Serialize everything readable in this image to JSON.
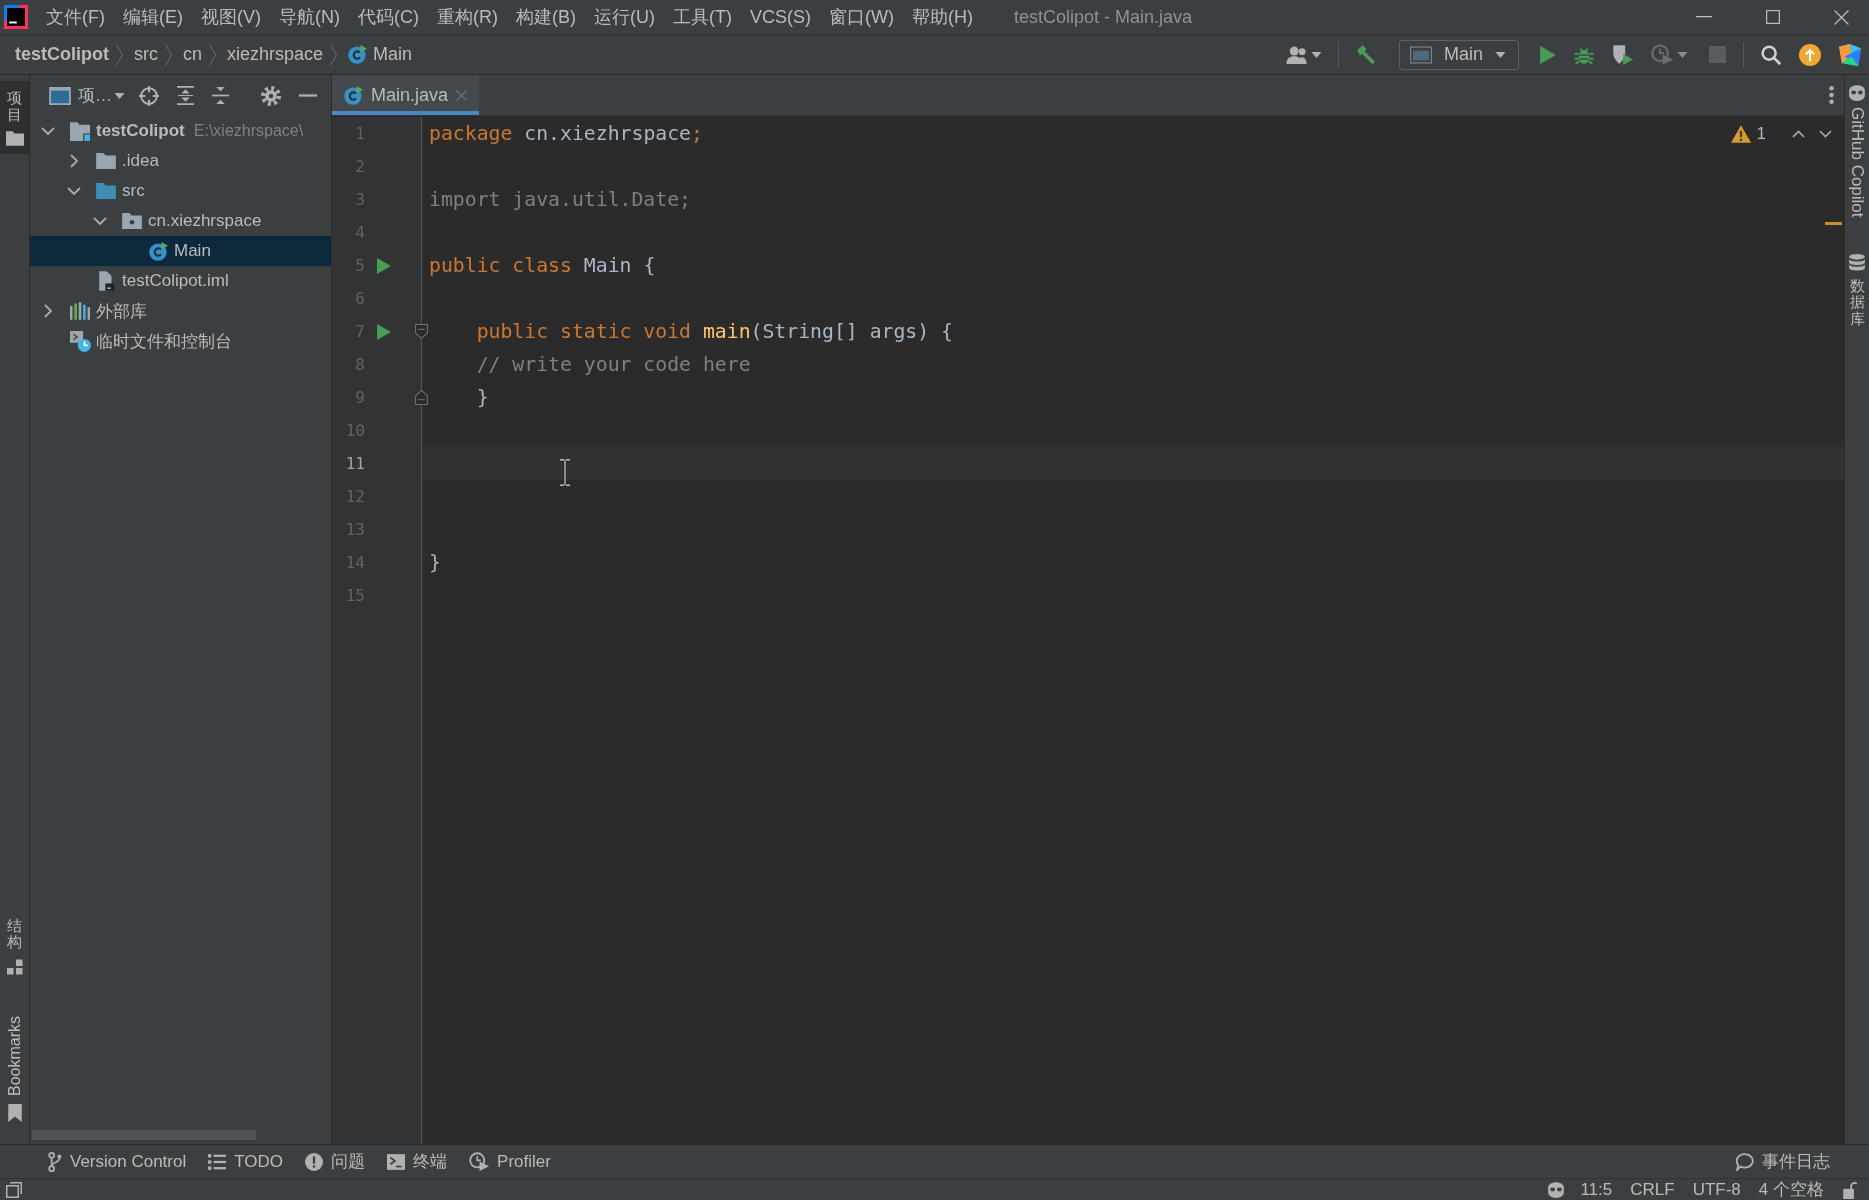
{
  "window": {
    "title": "testColipot - Main.java"
  },
  "menu": [
    "文件(F)",
    "编辑(E)",
    "视图(V)",
    "导航(N)",
    "代码(C)",
    "重构(R)",
    "构建(B)",
    "运行(U)",
    "工具(T)",
    "VCS(S)",
    "窗口(W)",
    "帮助(H)"
  ],
  "breadcrumbs": [
    {
      "label": "testColipot",
      "kind": "project"
    },
    {
      "label": "src",
      "kind": "folder"
    },
    {
      "label": "cn",
      "kind": "folder"
    },
    {
      "label": "xiezhrspace",
      "kind": "folder"
    },
    {
      "label": "Main",
      "kind": "class"
    }
  ],
  "run_configuration": {
    "label": "Main"
  },
  "left_stripe": {
    "top": [
      {
        "label": "项目",
        "kind": "project",
        "selected": true
      }
    ],
    "bottom": [
      {
        "label": "结构",
        "kind": "structure",
        "selected": false
      },
      {
        "label": "Bookmarks",
        "kind": "bookmarks",
        "selected": false
      }
    ]
  },
  "project_panel": {
    "view": "项…",
    "tree": [
      {
        "label": "testColipot",
        "kind": "project",
        "path": "E:\\xiezhrspace\\",
        "expanded": true,
        "selected": false,
        "children": [
          {
            "label": ".idea",
            "kind": "folder",
            "expanded": false,
            "selected": false
          },
          {
            "label": "src",
            "kind": "source_folder",
            "expanded": true,
            "selected": false,
            "children": [
              {
                "label": "cn.xiezhrspace",
                "kind": "package",
                "expanded": true,
                "selected": false,
                "children": [
                  {
                    "label": "Main",
                    "kind": "class",
                    "selected": true
                  }
                ]
              }
            ]
          },
          {
            "label": "testColipot.iml",
            "kind": "module_file",
            "selected": false
          }
        ]
      },
      {
        "label": "外部库",
        "kind": "library",
        "expanded": false,
        "selected": false
      },
      {
        "label": "临时文件和控制台",
        "kind": "scratches",
        "selected": false
      }
    ]
  },
  "tabs": [
    {
      "label": "Main.java",
      "kind": "class",
      "selected": true
    }
  ],
  "editor": {
    "warnings": "1",
    "lines": [
      {
        "number": "1",
        "kind": "plain",
        "run_marker": false,
        "current": false,
        "tokens": [
          {
            "text": "package",
            "kind": "keyword"
          },
          {
            "text": " cn.xiezhrspace",
            "kind": "plain"
          },
          {
            "text": ";",
            "kind": "keyword"
          }
        ]
      },
      {
        "number": "2",
        "kind": "plain",
        "run_marker": false,
        "current": false
      },
      {
        "number": "3",
        "kind": "plain",
        "run_marker": false,
        "current": false,
        "tokens": [
          {
            "text": "import java.util.Date;",
            "kind": "unused"
          }
        ]
      },
      {
        "number": "4",
        "kind": "plain",
        "run_marker": false,
        "current": false
      },
      {
        "number": "5",
        "kind": "plain",
        "run_marker": true,
        "current": false,
        "tokens": [
          {
            "text": "public class",
            "kind": "keyword"
          },
          {
            "text": " Main {",
            "kind": "plain"
          }
        ]
      },
      {
        "number": "6",
        "kind": "plain",
        "run_marker": false,
        "current": false
      },
      {
        "number": "7",
        "kind": "fold_start",
        "run_marker": true,
        "current": false,
        "tokens": [
          {
            "text": "    public static void",
            "kind": "keyword"
          },
          {
            "text": " main",
            "kind": "method"
          },
          {
            "text": "(String[] args) {",
            "kind": "plain"
          }
        ]
      },
      {
        "number": "8",
        "kind": "plain",
        "run_marker": false,
        "current": false,
        "tokens": [
          {
            "text": "    // write your code here",
            "kind": "comment"
          }
        ]
      },
      {
        "number": "9",
        "kind": "fold_end",
        "run_marker": false,
        "current": false,
        "tokens": [
          {
            "text": "    }",
            "kind": "plain"
          }
        ]
      },
      {
        "number": "10",
        "kind": "plain",
        "run_marker": false,
        "current": false
      },
      {
        "number": "11",
        "kind": "plain",
        "run_marker": false,
        "current": true
      },
      {
        "number": "12",
        "kind": "plain",
        "run_marker": false,
        "current": false
      },
      {
        "number": "13",
        "kind": "plain",
        "run_marker": false,
        "current": false
      },
      {
        "number": "14",
        "kind": "plain",
        "run_marker": false,
        "current": false,
        "tokens": [
          {
            "text": "}",
            "kind": "plain"
          }
        ]
      },
      {
        "number": "15",
        "kind": "plain",
        "run_marker": false,
        "current": false
      }
    ]
  },
  "right_stripe": [
    {
      "label": "GitHub Copilot",
      "kind": "copilot"
    },
    {
      "label": "数据库",
      "kind": "database"
    }
  ],
  "tool_windows": [
    {
      "label": "Version Control",
      "kind": "vcs"
    },
    {
      "label": "TODO",
      "kind": "todo"
    },
    {
      "label": "问题",
      "kind": "problems"
    },
    {
      "label": "终端",
      "kind": "terminal"
    },
    {
      "label": "Profiler",
      "kind": "profiler"
    }
  ],
  "event_log": {
    "label": "事件日志"
  },
  "status_bar": [
    "11:5",
    "CRLF",
    "UTF-8",
    "4 个空格"
  ]
}
